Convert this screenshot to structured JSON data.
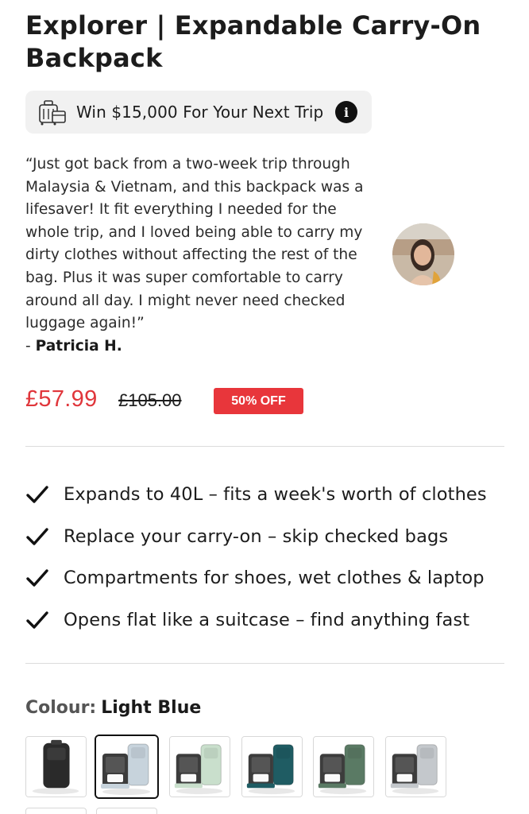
{
  "product": {
    "title": "Explorer | Expandable Carry-On Backpack"
  },
  "promo": {
    "text": "Win $15,000 For Your Next Trip",
    "icon": "luggage-icon",
    "info_icon": "info-icon",
    "info_glyph": "i"
  },
  "review": {
    "quote": "“Just got back from a two-week trip through Malaysia & Vietnam, and this backpack was a lifesaver! It fit everything I needed for the whole trip, and I loved being able to carry my dirty clothes without affecting the rest of the bag. Plus it was super comfortable to carry around all day. I might never need checked luggage again!”",
    "author_prefix": "- ",
    "author": "Patricia H."
  },
  "pricing": {
    "sale_price": "£57.99",
    "original_price": "£105.00",
    "discount_badge": "50% OFF",
    "sale_color": "#e0363b",
    "badge_color": "#e8363b"
  },
  "features": [
    "Expands to 40L – fits a week's worth of clothes",
    "Replace your carry-on – skip checked bags",
    "Compartments for shoes, wet clothes & laptop",
    "Opens flat like a suitcase – find anything fast"
  ],
  "colour": {
    "label": "Colour:",
    "selected": "Light Blue",
    "swatches": [
      {
        "name": "Black",
        "color": "#2a2a2a",
        "selected": false
      },
      {
        "name": "Light Blue",
        "color": "#c7d3dc",
        "selected": true
      },
      {
        "name": "Mint Green",
        "color": "#c9dfcc",
        "selected": false
      },
      {
        "name": "Teal",
        "color": "#1f5c63",
        "selected": false
      },
      {
        "name": "Olive Green",
        "color": "#5a7a64",
        "selected": false
      },
      {
        "name": "Grey",
        "color": "#c4c8cc",
        "selected": false
      }
    ]
  }
}
